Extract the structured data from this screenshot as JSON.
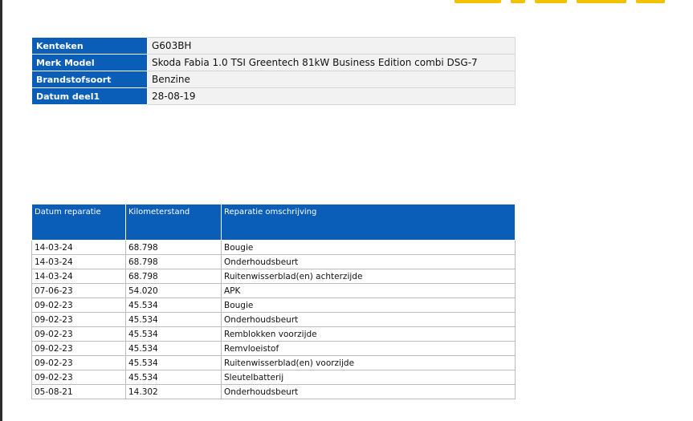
{
  "vehicle": {
    "rows": [
      {
        "label": "Kenteken",
        "value": "G603BH"
      },
      {
        "label": "Merk Model",
        "value": "Skoda Fabia 1.0 TSI Greentech 81kW Business Edition combi DSG-7"
      },
      {
        "label": "Brandstofsoort",
        "value": "Benzine"
      },
      {
        "label": "Datum deel1",
        "value": "28-08-19"
      }
    ]
  },
  "repairs": {
    "headers": [
      "Datum reparatie",
      "Kilometerstand",
      "Reparatie omschrijving"
    ],
    "rows": [
      [
        "14-03-24",
        "68.798",
        "Bougie"
      ],
      [
        "14-03-24",
        "68.798",
        "Onderhoudsbeurt"
      ],
      [
        "14-03-24",
        "68.798",
        "Ruitenwisserblad(en) achterzijde"
      ],
      [
        "07-06-23",
        "54.020",
        "APK"
      ],
      [
        "09-02-23",
        "45.534",
        "Bougie"
      ],
      [
        "09-02-23",
        "45.534",
        "Onderhoudsbeurt"
      ],
      [
        "09-02-23",
        "45.534",
        "Remblokken voorzijde"
      ],
      [
        "09-02-23",
        "45.534",
        "Remvloeistof"
      ],
      [
        "09-02-23",
        "45.534",
        "Ruitenwisserblad(en) voorzijde"
      ],
      [
        "09-02-23",
        "45.534",
        "Sleutelbatterij"
      ],
      [
        "05-08-21",
        "14.302",
        "Onderhoudsbeurt"
      ]
    ]
  },
  "colors": {
    "header_blue": "#0b5eb8",
    "label_background": "#f2f2f2",
    "accent_yellow": "#f2c200"
  }
}
